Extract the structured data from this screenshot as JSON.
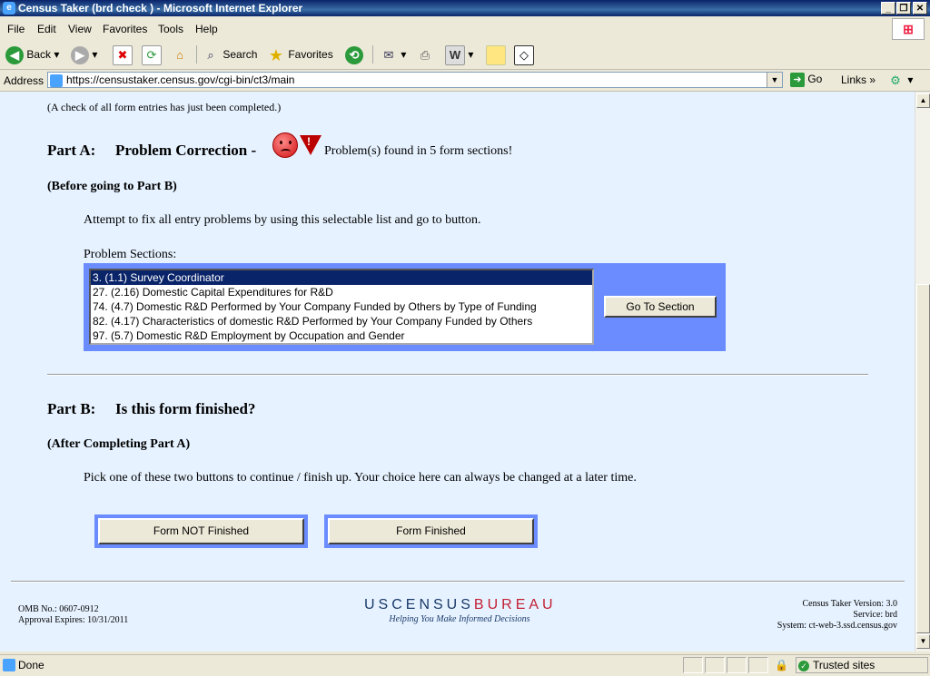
{
  "window": {
    "title": "Census Taker (brd check ) - Microsoft Internet Explorer",
    "min": "_",
    "max": "❐",
    "close": "✕"
  },
  "menu": [
    "File",
    "Edit",
    "View",
    "Favorites",
    "Tools",
    "Help"
  ],
  "toolbar": {
    "back": "Back",
    "search": "Search",
    "favorites": "Favorites"
  },
  "address": {
    "label": "Address",
    "url": "https://censustaker.census.gov/cgi-bin/ct3/main",
    "go": "Go",
    "links": "Links"
  },
  "page": {
    "note": "(A check of all form entries has just been completed.)",
    "partA": {
      "label": "Part A:",
      "title": "Problem Correction -",
      "status": "Problem(s) found in 5 form sections!",
      "subtitle": "(Before going to Part B)",
      "instruction": "Attempt to fix all entry problems by using this selectable list and go to button.",
      "list_label": "Problem Sections:",
      "options": [
        "3. (1.1) Survey Coordinator",
        "27. (2.16) Domestic Capital Expenditures for R&D",
        "74. (4.7) Domestic R&D Performed by Your Company Funded by Others by Type of Funding",
        "82. (4.17) Characteristics of domestic R&D Performed by Your Company Funded by Others",
        "97. (5.7) Domestic R&D Employment by Occupation and Gender"
      ],
      "selected_index": 0,
      "go_button": "Go To Section"
    },
    "partB": {
      "label": "Part B:",
      "title": "Is this form finished?",
      "subtitle": "(After Completing Part A)",
      "instruction": "Pick one of these two buttons to continue / finish up. Your choice here can always be changed at a later time.",
      "not_finished": "Form NOT Finished",
      "finished": "Form Finished"
    },
    "footer": {
      "omb": "OMB No.: 0607-0912",
      "expires": "Approval Expires: 10/31/2011",
      "logo_us": "USCENSUS",
      "logo_bureau": "BUREAU",
      "tagline": "Helping You Make Informed Decisions",
      "version": "Census Taker Version: 3.0",
      "service": "Service: brd",
      "system": "System: ct-web-3.ssd.census.gov"
    }
  },
  "status": {
    "text": "Done",
    "zone": "Trusted sites"
  },
  "colors": {
    "panel_blue": "#6b8cff",
    "page_bg": "#e6f2ff",
    "selection": "#0a246a"
  }
}
